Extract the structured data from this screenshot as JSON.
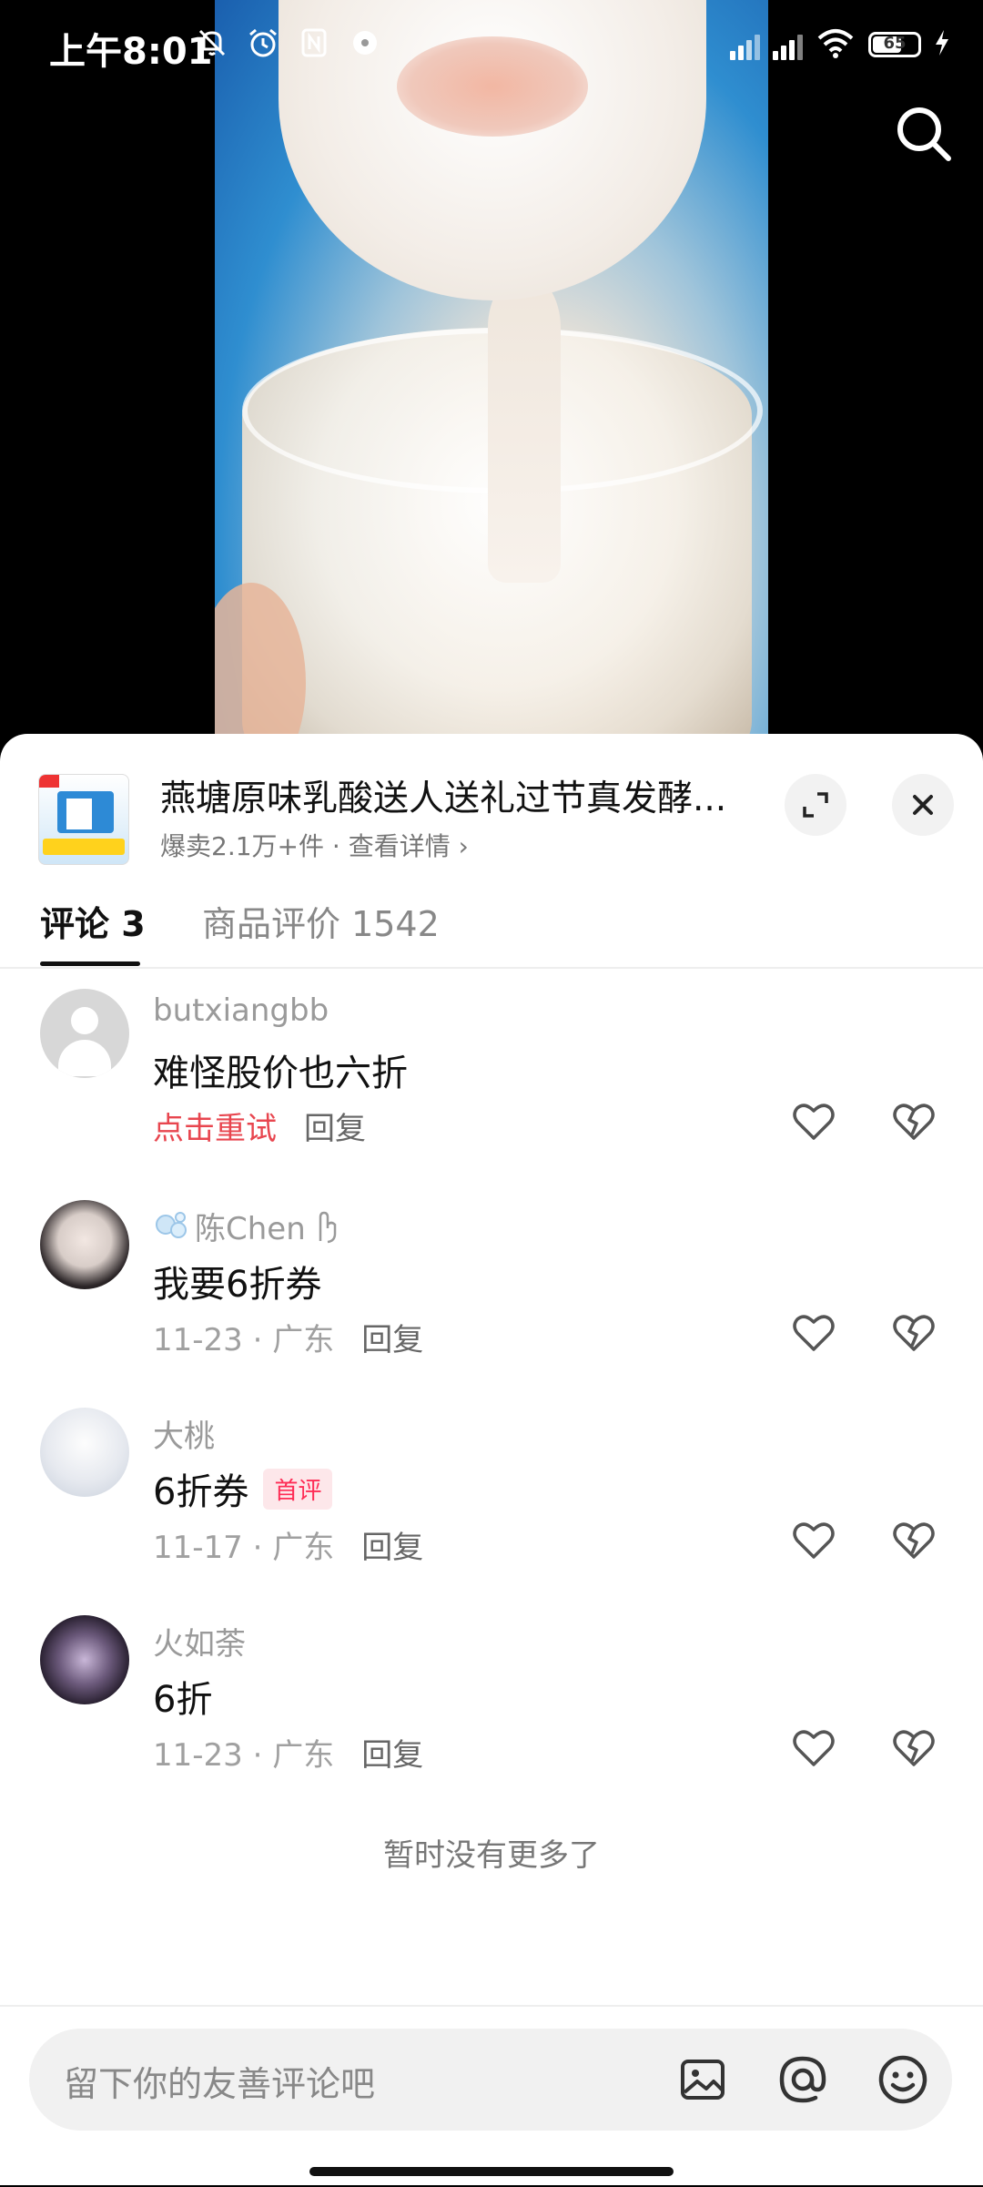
{
  "status_bar": {
    "time": "上午8:01",
    "battery": "65"
  },
  "product": {
    "title": "燕塘原味乳酸送人送礼过节真发酵...",
    "subtitle": "爆卖2.1万+件 · 查看详情 ›"
  },
  "tabs": [
    {
      "label": "评论 3"
    },
    {
      "label": "商品评价 1542"
    }
  ],
  "comments": [
    {
      "name": "butxiangbb",
      "text": "难怪股价也六折",
      "status": "点击重试",
      "reply": "回复"
    },
    {
      "name": "陈Chen",
      "text": "我要6折券",
      "meta": "11-23 · 广东",
      "reply": "回复"
    },
    {
      "name": "大桃",
      "text": "6折券",
      "badge": "首评",
      "meta": "11-17 · 广东",
      "reply": "回复"
    },
    {
      "name": "火如荼",
      "text": "6折",
      "meta": "11-23 · 广东",
      "reply": "回复"
    }
  ],
  "no_more": "暂时没有更多了",
  "input": {
    "placeholder": "留下你的友善评论吧"
  },
  "colors": {
    "accent": "#fe2c55",
    "retry": "#e8464f"
  },
  "icons": [
    "search-icon",
    "expand-icon",
    "close-icon",
    "like-icon",
    "dislike-icon",
    "image-icon",
    "mention-icon",
    "emoji-icon"
  ]
}
